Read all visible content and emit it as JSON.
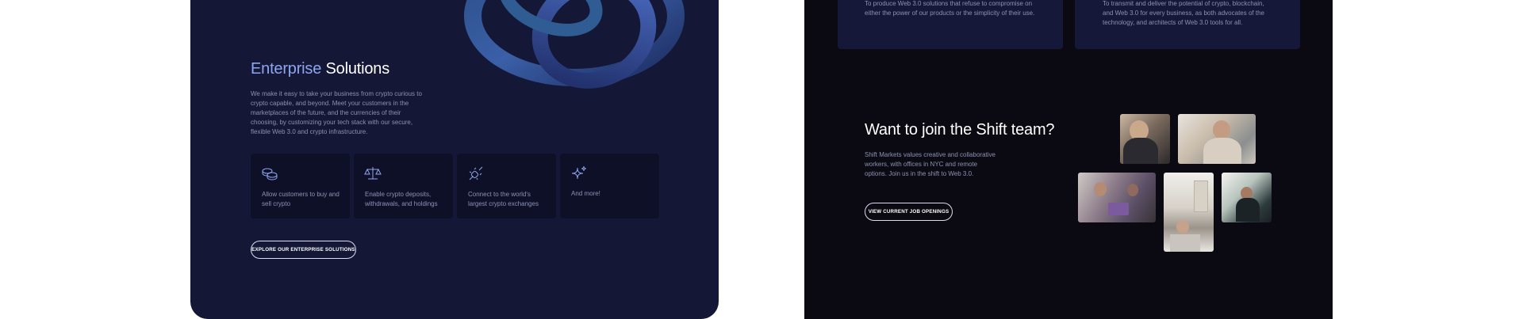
{
  "enterprise": {
    "title_accent": "Enterprise",
    "title_rest": " Solutions",
    "description": "We make it easy to take your business from crypto curious to crypto capable, and beyond. Meet your customers in the marketplaces of the future, and the currencies of their choosing, by customizing your tech stack with our secure, flexible Web 3.0 and crypto infrastructure.",
    "features": [
      {
        "icon": "coins-icon",
        "text": "Allow customers to buy and sell crypto"
      },
      {
        "icon": "scale-icon",
        "text": "Enable crypto deposits, withdrawals, and holdings"
      },
      {
        "icon": "plug-connect-icon",
        "text": "Connect to the world's largest crypto exchanges"
      },
      {
        "icon": "sparkle-icon",
        "text": "And more!"
      }
    ],
    "cta_label": "EXPLORE OUR ENTERPRISE SOLUTIONS",
    "accent_color": "#8ea6ef",
    "background": "#141735"
  },
  "join": {
    "top_cards": [
      {
        "text": "To produce Web 3.0 solutions that refuse to compromise on either the power of our products or the simplicity of their use."
      },
      {
        "text": "To transmit and deliver the potential of crypto, blockchain, and Web 3.0 for every business, as both advocates of the technology, and architects of Web 3.0 tools for all."
      }
    ],
    "title": "Want to join the Shift team?",
    "description": "Shift Markets values creative and collaborative workers, with offices in NYC and remote options. Join us in the shift to Web 3.0.",
    "cta_label": "VIEW CURRENT JOB OPENINGS",
    "background": "#0b0a12"
  }
}
